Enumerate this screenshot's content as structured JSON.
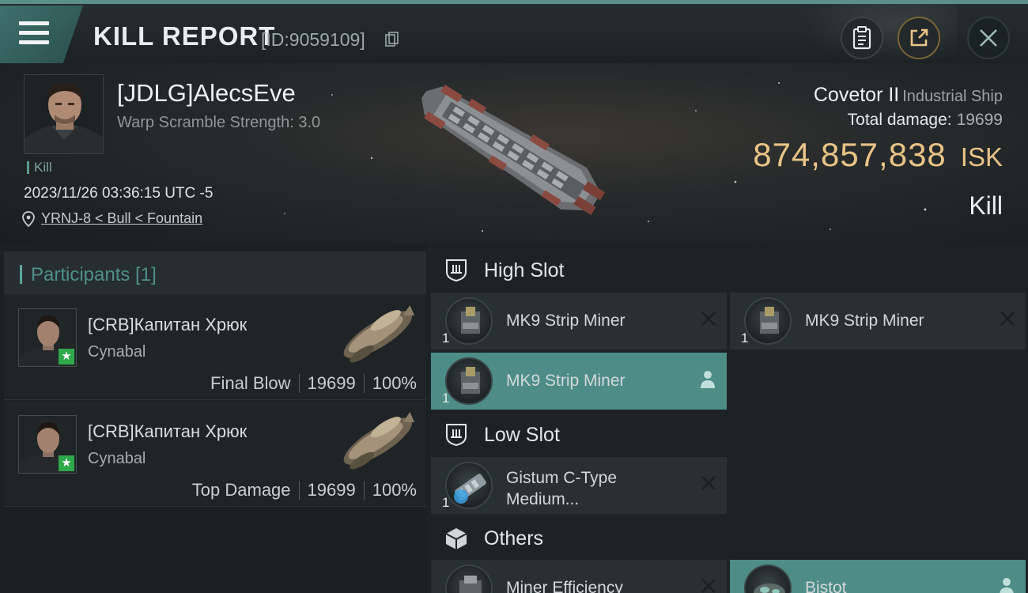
{
  "header": {
    "title": "KILL REPORT",
    "report_id": "[ID:9059109]",
    "icons": [
      "menu-icon",
      "copy-icon",
      "clipboard-icon",
      "share-icon",
      "close-icon"
    ]
  },
  "victim": {
    "name": "[JDLG]AlecsEve",
    "warp_scramble": "Warp Scramble Strength: 3.0",
    "kill_tag": "Kill",
    "datetime": "2023/11/26 03:36:15 UTC -5",
    "location": "YRNJ-8 < Bull < Fountain"
  },
  "ship": {
    "name": "Covetor II",
    "class": "Industrial Ship",
    "total_damage_label": "Total damage:",
    "total_damage_value": "19699",
    "isk_value": "874,857,838",
    "isk_unit": "ISK",
    "result": "Kill"
  },
  "participants": {
    "title": "Participants [1]",
    "rows": [
      {
        "name": "[CRB]Капитан Хрюк",
        "ship": "Cynabal",
        "role": "Final Blow",
        "damage": "19699",
        "percent": "100%"
      },
      {
        "name": "[CRB]Капитан Хрюк",
        "ship": "Cynabal",
        "role": "Top Damage",
        "damage": "19699",
        "percent": "100%"
      }
    ]
  },
  "fitting": {
    "high_slot": {
      "label": "High Slot",
      "modules": [
        {
          "name": "MK9 Strip Miner",
          "qty": "1",
          "state": "destroyed"
        },
        {
          "name": "MK9 Strip Miner",
          "qty": "1",
          "state": "destroyed"
        },
        {
          "name": "MK9 Strip Miner",
          "qty": "1",
          "state": "dropped"
        }
      ]
    },
    "low_slot": {
      "label": "Low Slot",
      "modules": [
        {
          "name": "Gistum C-Type Medium...",
          "name_line1": "Gistum C-Type",
          "name_line2": "Medium...",
          "qty": "1",
          "state": "destroyed"
        }
      ]
    },
    "others": {
      "label": "Others",
      "modules": [
        {
          "name": "Miner Efficiency",
          "state": "destroyed"
        },
        {
          "name": "Bistot",
          "state": "dropped"
        }
      ]
    }
  },
  "colors": {
    "accent_teal": "#4d8c87",
    "isk_gold": "#e9c487",
    "background": "#14191b",
    "final_blow_badge": "#2ea84a"
  }
}
